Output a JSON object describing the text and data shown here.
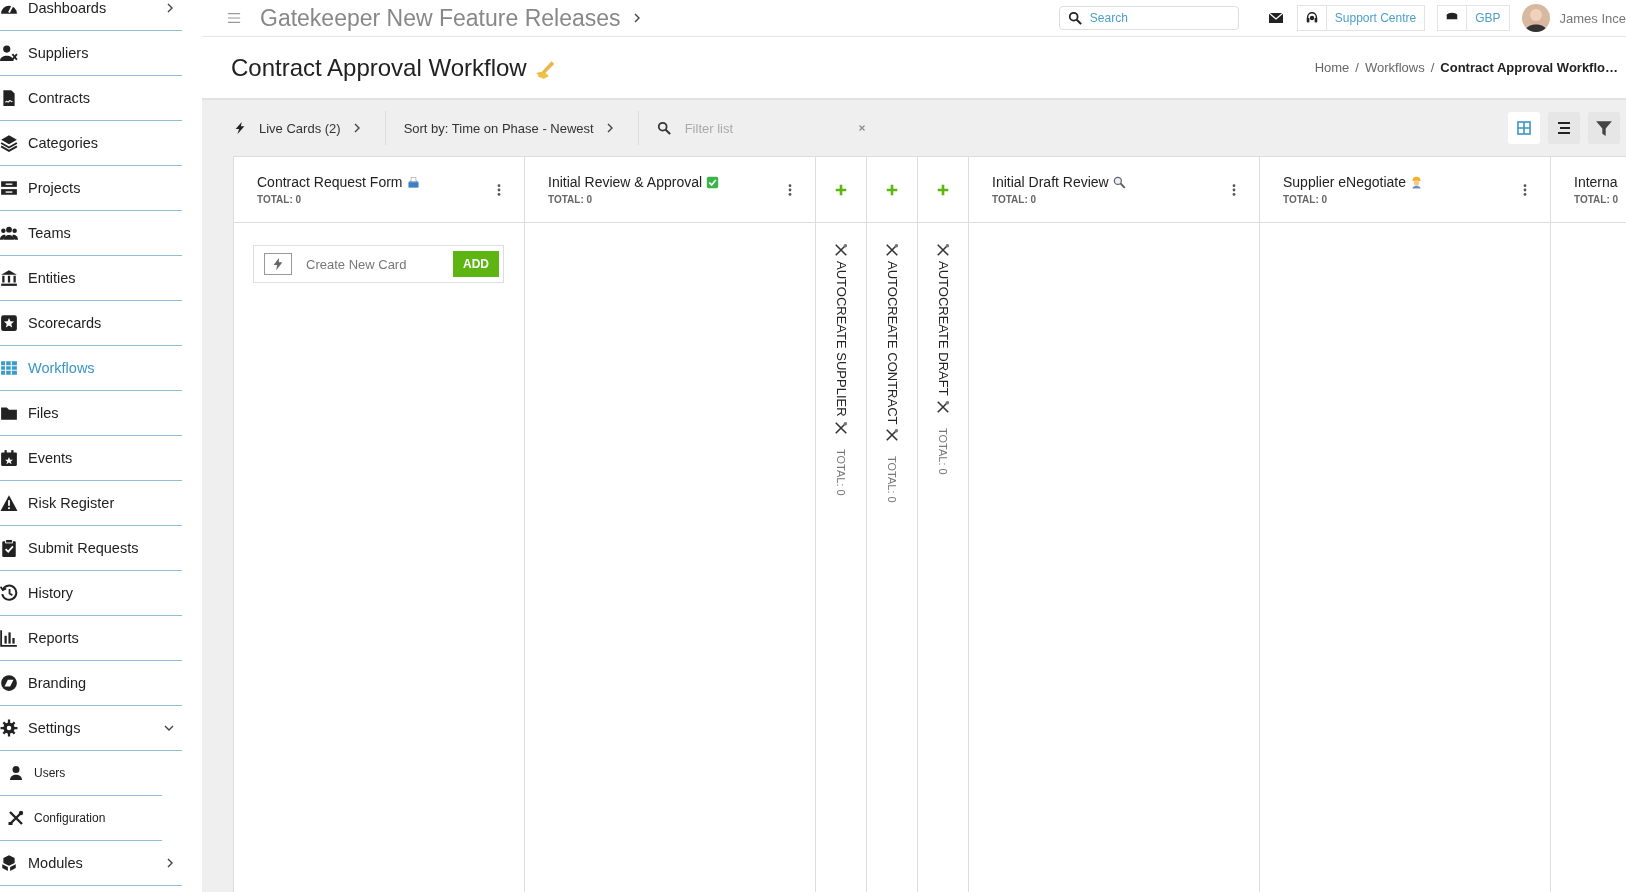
{
  "header": {
    "title": "Gatekeeper New Feature Releases",
    "search": {
      "placeholder": "Search"
    },
    "support": "Support Centre",
    "currency": "GBP",
    "user": "James Ince"
  },
  "sidebar": {
    "items": [
      {
        "label": "Dashboards",
        "selected": false,
        "expanded": false
      },
      {
        "label": "Suppliers",
        "selected": false
      },
      {
        "label": "Contracts",
        "selected": false
      },
      {
        "label": "Categories",
        "selected": false
      },
      {
        "label": "Projects",
        "selected": false
      },
      {
        "label": "Teams",
        "selected": false
      },
      {
        "label": "Entities",
        "selected": false
      },
      {
        "label": "Scorecards",
        "selected": false
      },
      {
        "label": "Workflows",
        "selected": true
      },
      {
        "label": "Files",
        "selected": false
      },
      {
        "label": "Events",
        "selected": false
      },
      {
        "label": "Risk Register",
        "selected": false
      },
      {
        "label": "Submit Requests",
        "selected": false
      },
      {
        "label": "History",
        "selected": false
      },
      {
        "label": "Reports",
        "selected": false
      },
      {
        "label": "Branding",
        "selected": false
      },
      {
        "label": "Settings",
        "selected": false,
        "expanded": true,
        "children": [
          {
            "label": "Users",
            "selected": false
          },
          {
            "label": "Configuration",
            "selected": false
          }
        ]
      },
      {
        "label": "Modules",
        "selected": false,
        "expanded": false
      }
    ]
  },
  "page": {
    "title": "Contract Approval Workflow",
    "separator": "/",
    "breadcrumbs": [
      {
        "label": "Home",
        "current": false
      },
      {
        "label": "Workflows",
        "current": false
      },
      {
        "label": "Contract Approval Workflo…",
        "current": true
      }
    ]
  },
  "toolbar": {
    "live_cards": "Live Cards (2)",
    "sort": "Sort by: Time on Phase - Newest",
    "filter": {
      "placeholder": "Filter list"
    },
    "views": [
      {
        "kind": "grid",
        "selected": true
      },
      {
        "kind": "list",
        "selected": false
      }
    ]
  },
  "board": {
    "columns": [
      {
        "kind": "phase",
        "title": "Contract Request Form",
        "total": "TOTAL: 0",
        "create_card": {
          "placeholder": "Create New Card",
          "button": "ADD"
        }
      },
      {
        "kind": "phase",
        "title": "Initial Review & Approval",
        "total": "TOTAL: 0"
      },
      {
        "kind": "autocreate",
        "label": "AUTOCREATE SUPPLIER",
        "total": "TOTAL: 0"
      },
      {
        "kind": "autocreate",
        "label": "AUTOCREATE CONTRACT",
        "total": "TOTAL: 0"
      },
      {
        "kind": "autocreate",
        "label": "AUTOCREATE DRAFT",
        "total": "TOTAL: 0"
      },
      {
        "kind": "phase",
        "title": "Initial Draft Review",
        "total": "TOTAL: 0"
      },
      {
        "kind": "phase",
        "title": "Supplier eNegotiate",
        "total": "TOTAL: 0"
      },
      {
        "kind": "phase",
        "title": "Interna",
        "total": "TOTAL: 0"
      }
    ]
  }
}
